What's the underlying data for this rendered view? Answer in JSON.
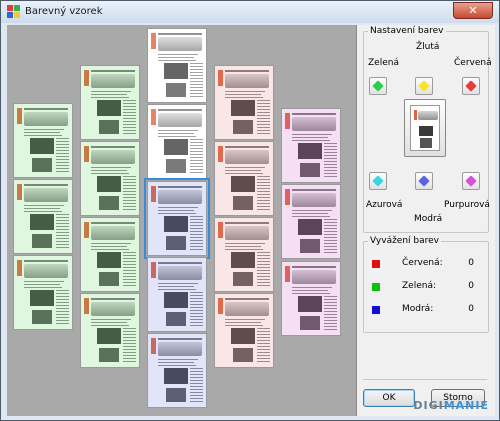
{
  "window": {
    "title": "Barevný vzorek",
    "close_label": "✕"
  },
  "settings": {
    "group_title": "Nastavení barev",
    "labels": {
      "yellow": "Žlutá",
      "green": "Zelená",
      "red": "Červená",
      "cyan": "Azurová",
      "blue": "Modrá",
      "magenta": "Purpurová"
    },
    "colors": {
      "yellow": "#f5e52a",
      "green": "#28d14a",
      "red": "#e83b3b",
      "cyan": "#38d6e2",
      "blue": "#5a63e8",
      "magenta": "#d84fd8"
    }
  },
  "balance": {
    "group_title": "Vyvážení barev",
    "rows": [
      {
        "label": "Červená:",
        "value": "0",
        "color": "#e01010"
      },
      {
        "label": "Zelená:",
        "value": "0",
        "color": "#10c010"
      },
      {
        "label": "Modrá:",
        "value": "0",
        "color": "#1010d0"
      }
    ]
  },
  "buttons": {
    "ok": "OK",
    "cancel": "Storno"
  },
  "watermark": {
    "part1": "DIGI",
    "part2": "MANIE"
  },
  "thumbnails": {
    "tints": {
      "green": "#6edc6e",
      "neutral": "#ffffff",
      "blue": "#7b83e8",
      "red": "#e58b8b",
      "magenta": "#d36fd3"
    }
  }
}
